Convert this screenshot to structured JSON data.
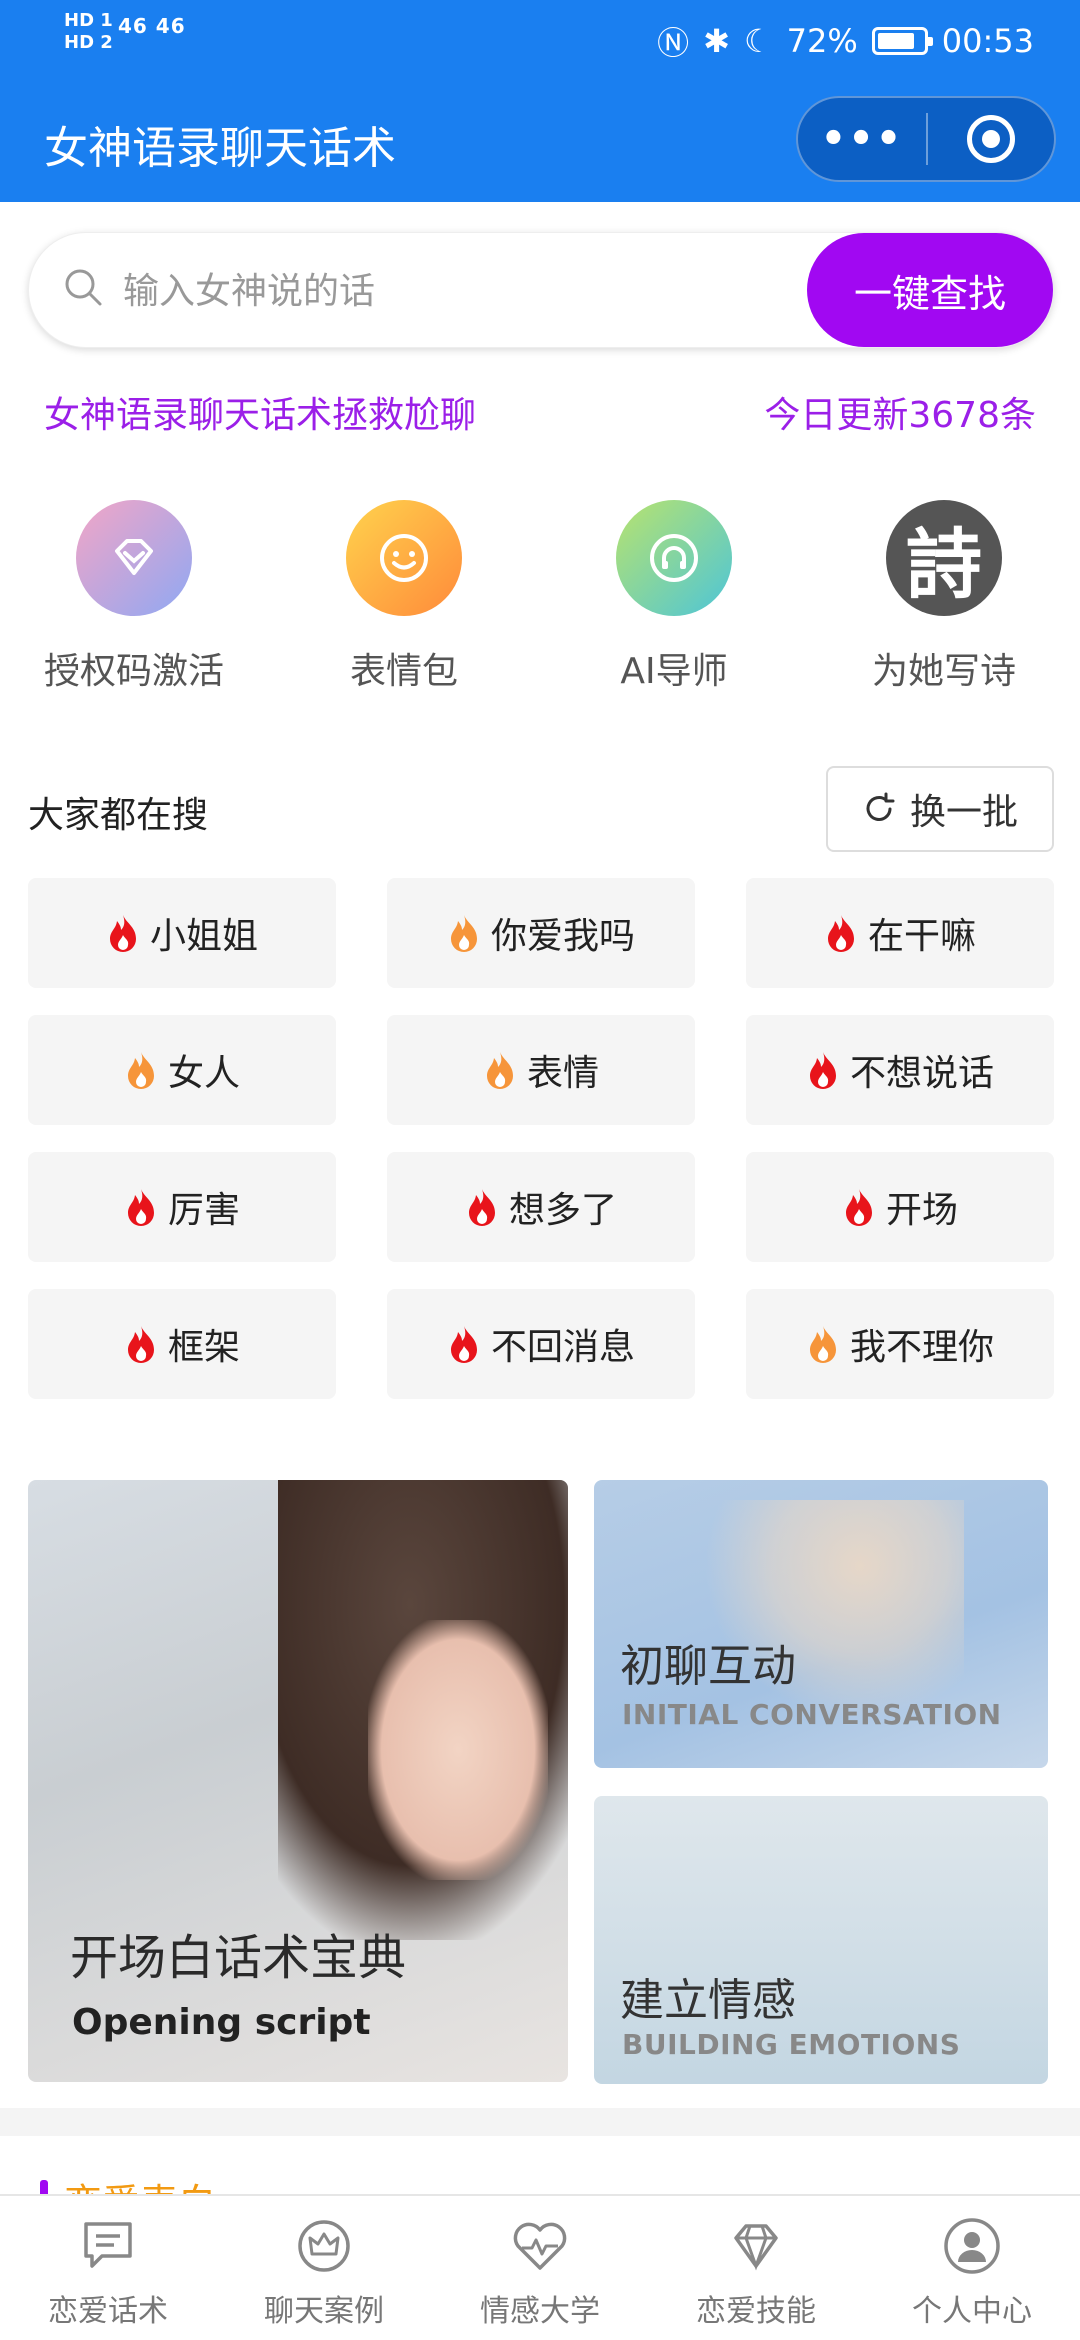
{
  "status_bar": {
    "network_left": "HD 1\nHD 2",
    "signal_text": "46 46",
    "battery": "72%",
    "time": "00:53"
  },
  "header": {
    "title": "女神语录聊天话术",
    "more_label": "•••"
  },
  "search": {
    "placeholder": "输入女神说的话",
    "value": "",
    "button_label": "一键查找"
  },
  "subline": {
    "left": "女神语录聊天话术拯救尬聊",
    "right": "今日更新3678条"
  },
  "quick_items": [
    {
      "label": "授权码激活",
      "icon": "gem-icon"
    },
    {
      "label": "表情包",
      "icon": "smile-icon"
    },
    {
      "label": "AI导师",
      "icon": "headphones-icon"
    },
    {
      "label": "为她写诗",
      "icon": "poem-icon",
      "icon_text": "詩"
    }
  ],
  "hot_search": {
    "title": "大家都在搜",
    "refresh_label": "换一批",
    "tags": [
      {
        "label": "小姐姐",
        "hot": "red"
      },
      {
        "label": "你爱我吗",
        "hot": "orange"
      },
      {
        "label": "在干嘛",
        "hot": "red"
      },
      {
        "label": "女人",
        "hot": "orange"
      },
      {
        "label": "表情",
        "hot": "orange"
      },
      {
        "label": "不想说话",
        "hot": "red"
      },
      {
        "label": "厉害",
        "hot": "red"
      },
      {
        "label": "想多了",
        "hot": "red"
      },
      {
        "label": "开场",
        "hot": "red"
      },
      {
        "label": "框架",
        "hot": "red"
      },
      {
        "label": "不回消息",
        "hot": "red"
      },
      {
        "label": "我不理你",
        "hot": "orange"
      }
    ]
  },
  "cards": {
    "big": {
      "title": "开场白话术宝典",
      "subtitle": "Opening script"
    },
    "a": {
      "title": "初聊互动",
      "subtitle": "INITIAL CONVERSATION"
    },
    "b": {
      "title": "建立情感",
      "subtitle": "BUILDING EMOTIONS"
    }
  },
  "section_peek": {
    "title": "恋爱表白"
  },
  "tabbar": [
    {
      "label": "恋爱话术",
      "icon": "chat-icon"
    },
    {
      "label": "聊天案例",
      "icon": "crown-icon"
    },
    {
      "label": "情感大学",
      "icon": "heartbeat-icon"
    },
    {
      "label": "恋爱技能",
      "icon": "diamond-icon"
    },
    {
      "label": "个人中心",
      "icon": "user-icon"
    }
  ],
  "colors": {
    "header_bg": "#1a7ff0",
    "accent_purple": "#a108f2",
    "hot_red": "#e8141b",
    "hot_orange": "#f6953a"
  }
}
